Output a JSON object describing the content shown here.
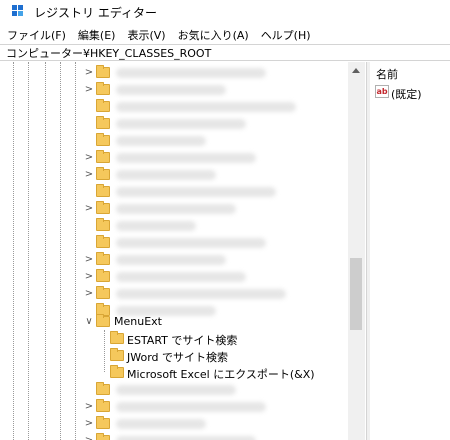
{
  "window": {
    "title": "レジストリ エディター",
    "icon": "regedit-icon"
  },
  "menu": [
    {
      "label": "ファイル(F)"
    },
    {
      "label": "編集(E)"
    },
    {
      "label": "表示(V)"
    },
    {
      "label": "お気に入り(A)"
    },
    {
      "label": "ヘルプ(H)"
    }
  ],
  "address": {
    "path": "コンピューター¥HKEY_CLASSES_ROOT"
  },
  "tree": {
    "expanded_key": {
      "label": "MenuExt"
    },
    "children": [
      {
        "label": "ESTART でサイト検索"
      },
      {
        "label": "JWord でサイト検索"
      },
      {
        "label": "Microsoft Excel にエクスポート(&X)"
      }
    ]
  },
  "values_pane": {
    "column_name_header": "名前",
    "entries": [
      {
        "name": "(既定)",
        "type_icon": "string-value-icon",
        "icon_text": "ab"
      }
    ]
  },
  "colors": {
    "folder": "#f5c85c",
    "folder_border": "#d9a635",
    "scroll_thumb": "#cdcdcd"
  }
}
